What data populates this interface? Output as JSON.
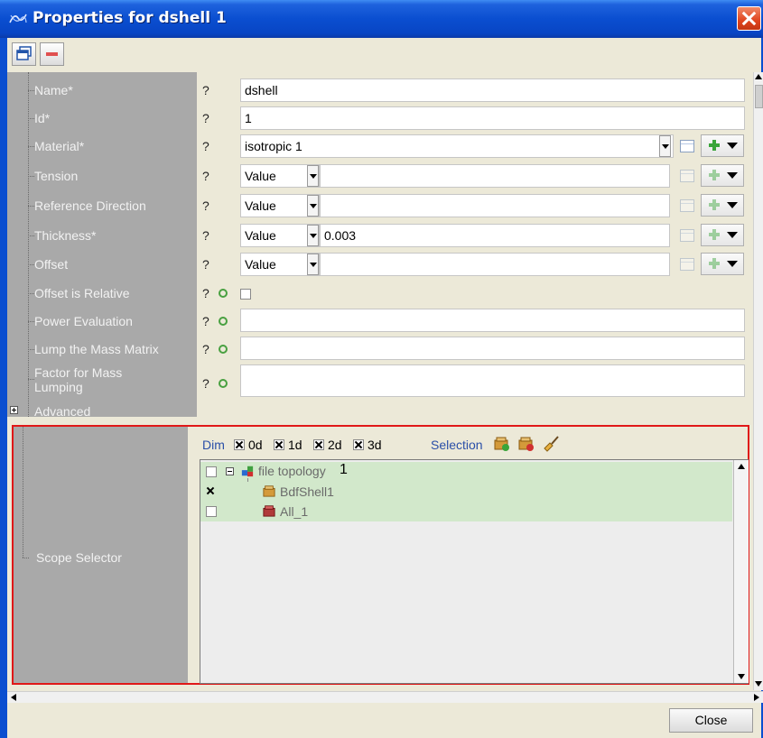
{
  "window": {
    "title": "Properties for dshell 1"
  },
  "toolbar": {
    "tool1": "restore",
    "tool2": "minus"
  },
  "properties": [
    {
      "label": "Name*",
      "help": "?",
      "value": "dshell"
    },
    {
      "label": "Id*",
      "help": "?",
      "value": "1"
    },
    {
      "label": "Material*",
      "help": "?",
      "value": "isotropic 1"
    },
    {
      "label": "Tension",
      "help": "?",
      "mode": "Value",
      "value": ""
    },
    {
      "label": "Reference Direction",
      "help": "?",
      "mode": "Value",
      "value": ""
    },
    {
      "label": "Thickness*",
      "help": "?",
      "mode": "Value",
      "value": "0.003"
    },
    {
      "label": "Offset",
      "help": "?",
      "mode": "Value",
      "value": ""
    },
    {
      "label": "Offset is Relative",
      "help": "?",
      "value": ""
    },
    {
      "label": "Power Evaluation",
      "help": "?",
      "value": ""
    },
    {
      "label": "Lump the Mass Matrix",
      "help": "?",
      "value": ""
    },
    {
      "label": "Factor for Mass Lumping",
      "help": "?",
      "value": ""
    },
    {
      "label": "Advanced"
    }
  ],
  "scope": {
    "label": "Scope Selector",
    "dim_label": "Dim",
    "dims": [
      "0d",
      "1d",
      "2d",
      "3d"
    ],
    "selection_label": "Selection",
    "tree": [
      {
        "label": "file topology",
        "suffix": "1",
        "checked": false
      },
      {
        "label": "BdfShell1",
        "checked": true
      },
      {
        "label": "All_1",
        "checked": false
      }
    ]
  },
  "buttons": {
    "close": "Close"
  },
  "colors": {
    "titlebar": "#0a4ed0",
    "highlight_border": "#e01818",
    "tree_selected": "#d2e8cb",
    "label_column": "#a9a9a9"
  }
}
